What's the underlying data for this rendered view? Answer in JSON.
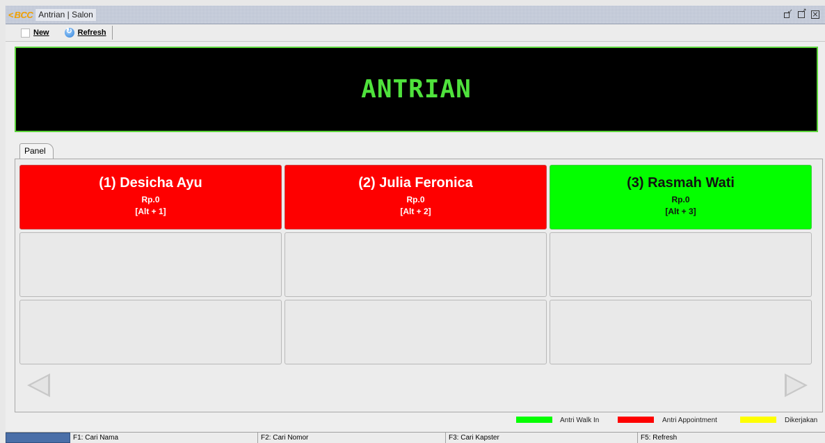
{
  "window": {
    "logo_arrow": "<",
    "logo_text": "BCC",
    "title": "Antrian | Salon"
  },
  "toolbar": {
    "new_label": "New",
    "refresh_label": "Refresh"
  },
  "banner": {
    "text": "ANTRIAN",
    "text_color": "#4fe23c",
    "background": "#000000"
  },
  "tab": {
    "label": "Panel"
  },
  "queue": [
    {
      "name": "(1) Desicha Ayu",
      "price": "Rp.0",
      "shortcut": "[Alt + 1]",
      "status_color": "#fe0000"
    },
    {
      "name": "(2) Julia Feronica",
      "price": "Rp.0",
      "shortcut": "[Alt + 2]",
      "status_color": "#fe0000"
    },
    {
      "name": "(3) Rasmah Wati",
      "price": "Rp.0",
      "shortcut": "[Alt + 3]",
      "status_color": "#04fe00"
    }
  ],
  "legend": [
    {
      "label": "Antri Walk In",
      "color": "#04fe00"
    },
    {
      "label": "Antri Appointment",
      "color": "#fe0000"
    },
    {
      "label": "Dikerjakan",
      "color": "#fefe00"
    }
  ],
  "statusbar": {
    "items": [
      "F1: Cari Nama",
      "F2: Cari Nomor",
      "F3: Cari Kapster",
      "F5: Refresh"
    ]
  }
}
